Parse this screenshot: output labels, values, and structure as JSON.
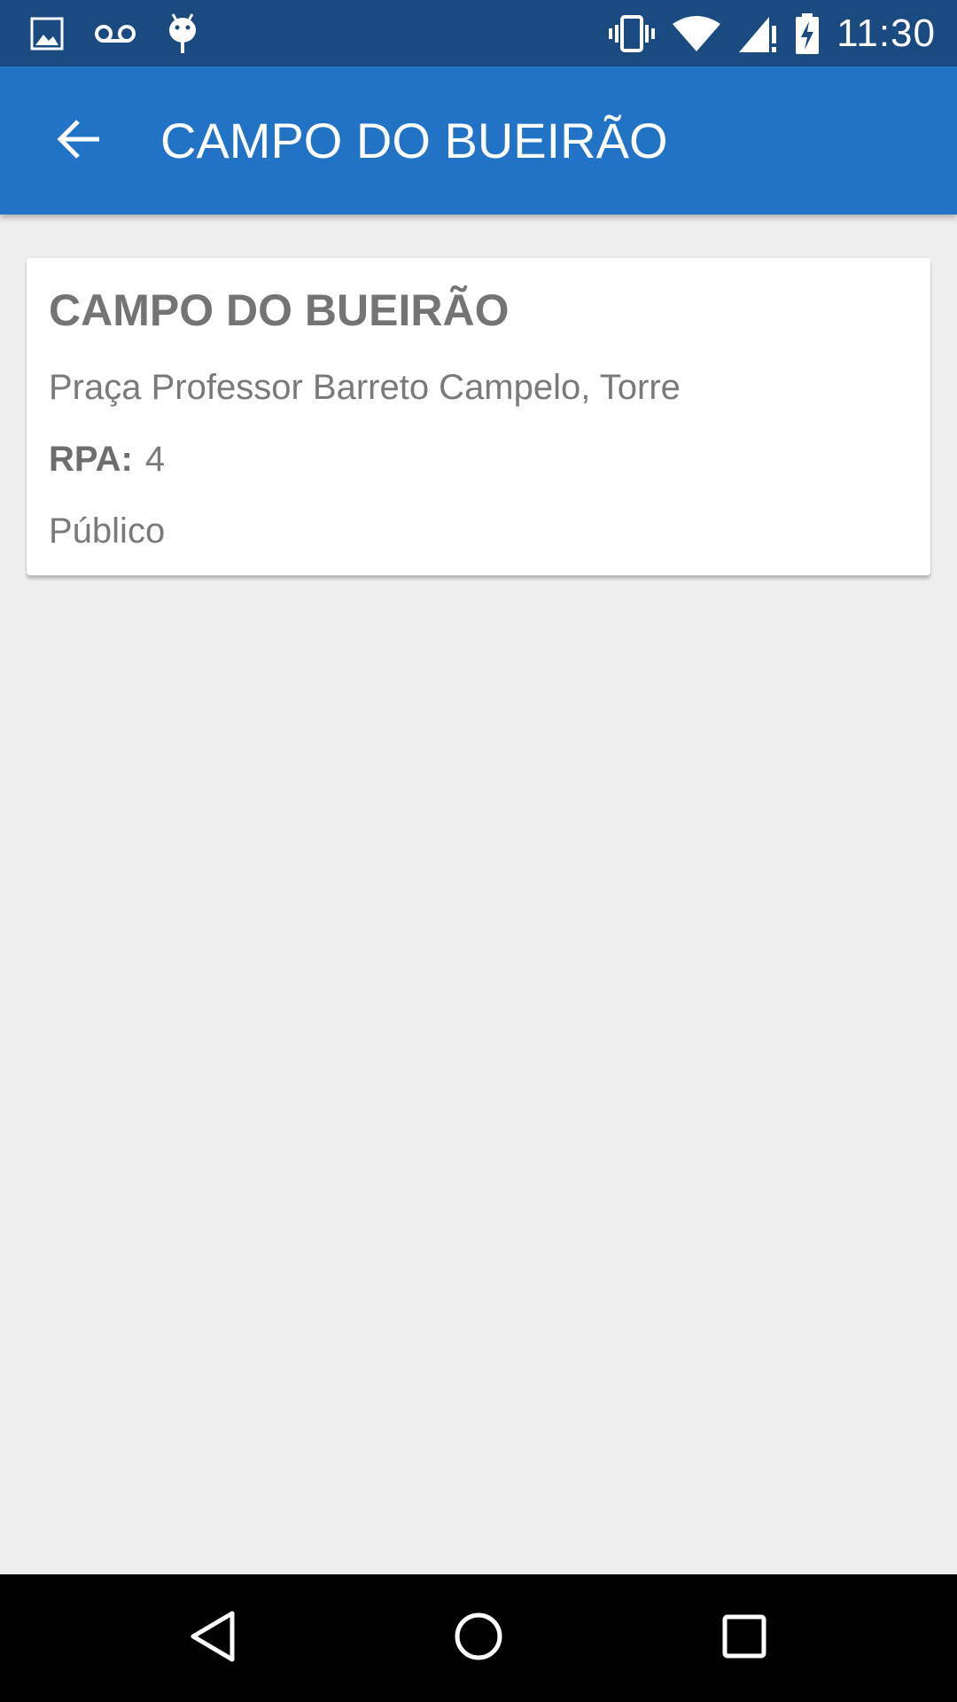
{
  "status_bar": {
    "time": "11:30",
    "left_icons": [
      "image-icon",
      "voicemail-icon",
      "android-debug-icon"
    ],
    "right_icons": [
      "vibrate-icon",
      "wifi-icon",
      "signal-icon",
      "battery-charging-icon"
    ]
  },
  "app_bar": {
    "title": "CAMPO DO BUEIRÃO",
    "back_icon": "arrow-back-icon"
  },
  "card": {
    "title": "CAMPO DO BUEIRÃO",
    "address": "Praça Professor Barreto Campelo, Torre",
    "rpa_label": "RPA:",
    "rpa_value": "4",
    "type": "Público"
  },
  "nav_bar": {
    "buttons": [
      "back-nav-icon",
      "home-nav-icon",
      "recents-nav-icon"
    ]
  },
  "colors": {
    "status_bar": "#1a4a80",
    "app_bar": "#2272c6",
    "background": "#eeeeee",
    "card": "#ffffff",
    "card_text": "#7a7a7a"
  }
}
